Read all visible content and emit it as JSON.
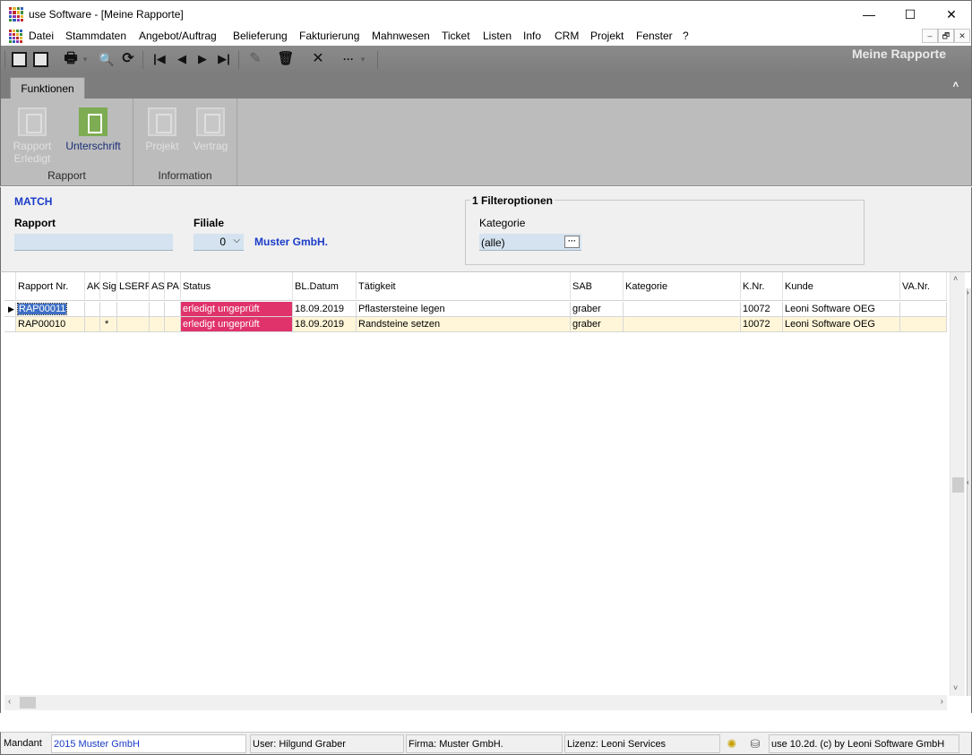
{
  "window": {
    "title": "use Software - [Meine Rapporte]",
    "minimize": "—",
    "maximize": "☐",
    "close": "✕"
  },
  "menu": {
    "items": [
      "Datei",
      "Stammdaten",
      "Angebot/Auftrag",
      "Belieferung",
      "Fakturierung",
      "Mahnwesen",
      "Ticket",
      "Listen",
      "Info",
      "CRM",
      "Projekt",
      "Fenster",
      "?"
    ],
    "mdi": [
      "–",
      "🗗",
      "✕"
    ]
  },
  "toolbar": {
    "page_title": "Meine Rapporte",
    "icons": [
      "new-icon",
      "save-icon",
      "print-icon",
      "search-icon",
      "refresh-icon",
      "first-record-icon",
      "previous-record-icon",
      "next-record-icon",
      "last-record-icon",
      "edit-icon",
      "delete-icon",
      "cancel-icon",
      "more-icon"
    ],
    "glyphs": {
      "first": "|◀",
      "prev": "◀",
      "next": "▶",
      "last": "▶|",
      "delete": "🗑",
      "cancel": "✕",
      "more": "···",
      "search": "🔍",
      "refresh": "⟳",
      "edit": "✎",
      "print": "🖶",
      "dropdown": "▾"
    }
  },
  "ribbon": {
    "tab": "Funktionen",
    "collapse": "˄",
    "groups": [
      {
        "label": "Rapport",
        "buttons": [
          {
            "line1": "Rapport",
            "line2": "Erledigt",
            "icon": "rapport-erledigt-icon",
            "enabled": false
          },
          {
            "line1": "Unterschrift",
            "line2": "",
            "icon": "signature-icon",
            "enabled": true
          }
        ]
      },
      {
        "label": "Information",
        "buttons": [
          {
            "line1": "Projekt",
            "line2": "",
            "icon": "project-icon",
            "enabled": false
          },
          {
            "line1": "Vertrag",
            "line2": "",
            "icon": "contract-icon",
            "enabled": false
          }
        ]
      }
    ]
  },
  "filter": {
    "match_label": "MATCH",
    "rapport_label": "Rapport",
    "rapport_value": "",
    "filiale_label": "Filiale",
    "filiale_value": "0",
    "filiale_chevron": "⌵",
    "filiale_name": "Muster GmbH.",
    "options_title": "1 Filteroptionen",
    "kategorie_label": "Kategorie",
    "kategorie_value": "(alle)",
    "kategorie_button": "···"
  },
  "table": {
    "columns": [
      "Rapport Nr.",
      "AK",
      "Sig",
      "LSERF",
      "AS",
      "PA",
      "Status",
      "BL.Datum",
      "Tätigkeit",
      "SAB",
      "Kategorie",
      "K.Nr.",
      "Kunde",
      "VA.Nr."
    ],
    "rows": [
      {
        "rapport_nr": "RAP00011",
        "ak": "",
        "sig": "",
        "lserf": "",
        "as": "",
        "pa": "",
        "status": "erledigt ungeprüft",
        "bl_datum": "18.09.2019",
        "taetigkeit": "Pflastersteine legen",
        "sab": "graber",
        "kategorie": "",
        "k_nr": "10072",
        "kunde": "Leoni Software OEG",
        "va_nr": ""
      },
      {
        "rapport_nr": "RAP00010",
        "ak": "",
        "sig": "*",
        "lserf": "",
        "as": "",
        "pa": "",
        "status": "erledigt ungeprüft",
        "bl_datum": "18.09.2019",
        "taetigkeit": "Randsteine setzen",
        "sab": "graber",
        "kategorie": "",
        "k_nr": "10072",
        "kunde": "Leoni Software OEG",
        "va_nr": ""
      }
    ],
    "row_indicator": "▶",
    "scroll": {
      "up": "˄",
      "down": "˅",
      "left": "‹",
      "right": "›",
      "split_left": "‹",
      "split_right": "›"
    }
  },
  "statusbar": {
    "mandant_label": "Mandant",
    "mandant_value": "2015 Muster GmbH",
    "user": "User: Hilgund Graber",
    "firma": "Firma: Muster GmbH.",
    "lizenz": "Lizenz: Leoni Services",
    "version": "use 10.2d. (c) by Leoni Software GmbH",
    "icon1": "✺",
    "icon2": "⛁"
  },
  "colors": {
    "status_red": "#e0336b",
    "selected_row": "#fff6d9",
    "accent_blue": "#1a3cc8",
    "ribbon_green": "#7dac52"
  }
}
